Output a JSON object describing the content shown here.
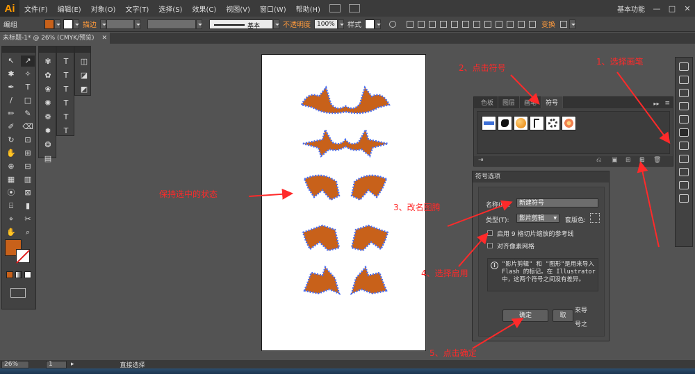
{
  "app": {
    "logo": "Ai"
  },
  "menu": {
    "items": [
      "文件(F)",
      "编辑(E)",
      "对象(O)",
      "文字(T)",
      "选择(S)",
      "效果(C)",
      "视图(V)",
      "窗口(W)",
      "帮助(H)"
    ],
    "workspace": "基本功能",
    "win_minimize": "—",
    "win_restore": "□",
    "win_close": "✕"
  },
  "controlbar": {
    "group_label": "编组",
    "fill_color": "#c8611a",
    "stroke_label": "描边",
    "stroke_style": "基本",
    "opacity_label": "不透明度",
    "opacity_value": "100%",
    "style_label": "样式",
    "transform_label": "变换"
  },
  "document": {
    "tab_title": "未标题-1* @ 26% (CMYK/预览)",
    "tab_close": "✕"
  },
  "tools": {
    "main": [
      "↖",
      "↗",
      "✱",
      "✧",
      "✒",
      "T",
      "/",
      "□",
      "✏",
      "✎",
      "✐",
      "⌫",
      "↻",
      "⊡",
      "✋",
      "⊞",
      "⊕",
      "⊟",
      "▦",
      "▥",
      "⦿",
      "⊠",
      "⌸",
      "▮",
      "⌖",
      "✂",
      "✋",
      "⌕"
    ],
    "fill_color": "#c8611a",
    "stroke_color": "#ffffff",
    "col2": [
      "✾",
      "✿",
      "❀",
      "✺",
      "❁",
      "✹",
      "❂",
      "▤"
    ],
    "col3": [
      "T",
      "T",
      "T",
      "T",
      "T",
      "T"
    ],
    "col4": [
      "◫",
      "◪",
      "◩"
    ]
  },
  "artboard": {
    "art_color": "#c8611a",
    "path_color": "#4a6ef0"
  },
  "symbols_panel": {
    "tabs": [
      "色板",
      "图层",
      "画笔",
      "符号"
    ],
    "active_tab": "符号",
    "menu_icon": "▸▸",
    "menu_btn": "≡",
    "footer_icons": [
      "⇥",
      "⎌",
      "▣",
      "⊞",
      "🗑"
    ]
  },
  "dialog": {
    "title": "符号选项",
    "name_label": "名称(N):",
    "name_value": "新建符号",
    "type_label": "类型(T):",
    "type_value": "影片剪辑",
    "registration_label": "套版色:",
    "enable_9slice": "启用 9 格切片缩放的参考线",
    "align_pixel_grid": "对齐像素网格",
    "info_icon": "i",
    "info_text": "\"影片剪辑\" 和 \"图形\"是用来导入 Flash 的标记。在 Illustrator 中，这两个符号之间没有差异。",
    "ok": "确定",
    "cancel_partial": "取",
    "right_text_1": "来导",
    "right_text_2": "号之"
  },
  "statusbar": {
    "zoom": "26%",
    "page": "1",
    "tool": "直接选择",
    "arrow": "▸"
  },
  "annotations": {
    "step1": "1、选择画笔",
    "step2": "2、点击符号",
    "step3": "3、改名图腾",
    "step4": "4、选择启用",
    "step5": "5、点击确定",
    "keep_selected": "保持选中的状态"
  }
}
